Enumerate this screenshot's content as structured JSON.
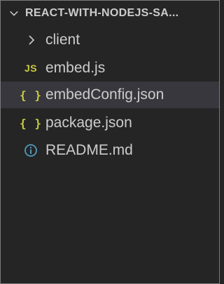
{
  "explorer": {
    "section_title": "REACT-WITH-NODEJS-SA...",
    "items": [
      {
        "label": "client",
        "icon": "chevron-right-icon",
        "kind": "folder"
      },
      {
        "label": "embed.js",
        "icon": "js-file-icon",
        "icon_text": "JS"
      },
      {
        "label": "embedConfig.json",
        "icon": "json-file-icon",
        "icon_text": "{ }",
        "selected": true
      },
      {
        "label": "package.json",
        "icon": "json-file-icon",
        "icon_text": "{ }"
      },
      {
        "label": "README.md",
        "icon": "info-icon",
        "icon_text": "i"
      }
    ],
    "colors": {
      "background": "#252526",
      "selected_row": "#37373d",
      "text": "#cccccc",
      "js_icon": "#cbcb41",
      "json_icon": "#cbcb41",
      "info_icon": "#519aba"
    }
  }
}
